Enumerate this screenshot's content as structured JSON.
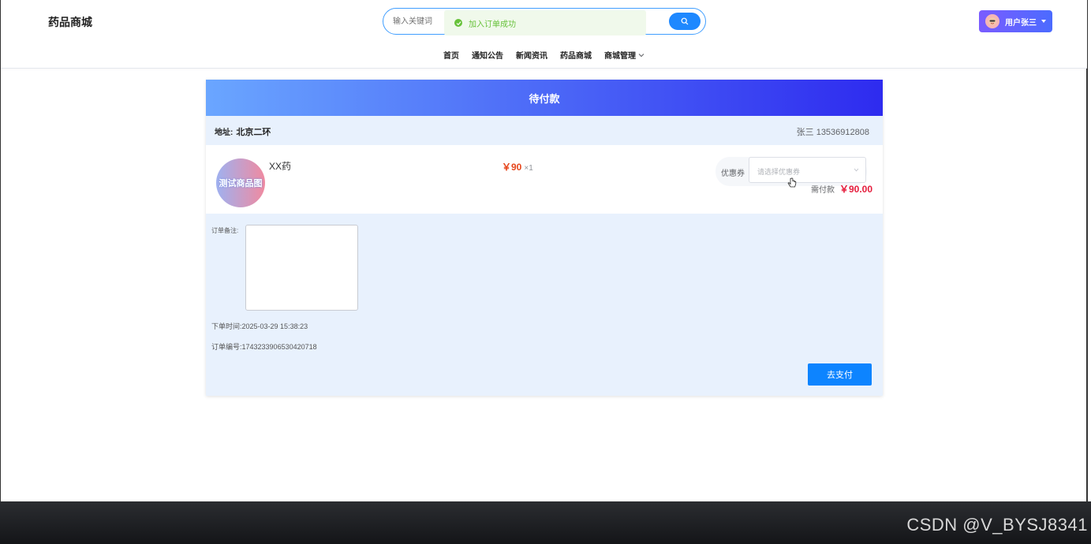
{
  "header": {
    "logo": "药品商城",
    "search_placeholder": "输入关键词",
    "toast": "加入订单成功",
    "user": "用户张三"
  },
  "nav": {
    "items": [
      "首页",
      "通知公告",
      "新闻资讯",
      "药品商城"
    ],
    "dropdown": "商城管理"
  },
  "order": {
    "status_title": "待付款",
    "address_label": "地址:",
    "address": "北京二环",
    "contact": "张三 13536912808",
    "item": {
      "image_text": "测试商品图",
      "name": "XX药",
      "price": "￥90",
      "qty": "×1"
    },
    "coupon_label": "优惠券",
    "coupon_placeholder": "请选择优惠券",
    "due_label": "需付款",
    "due_amount": "￥90.00",
    "remark_label": "订单备注:",
    "time_label": "下单时间:",
    "time": "2025-03-29 15:38:23",
    "no_label": "订单编号:",
    "no": "1743233906530420718",
    "pay_button": "去支付"
  },
  "watermark": "CSDN @V_BYSJ8341",
  "colors": {
    "accent": "#0d84ff",
    "success": "#67c23a",
    "price": "#e6461c",
    "due": "#e51c3c"
  }
}
